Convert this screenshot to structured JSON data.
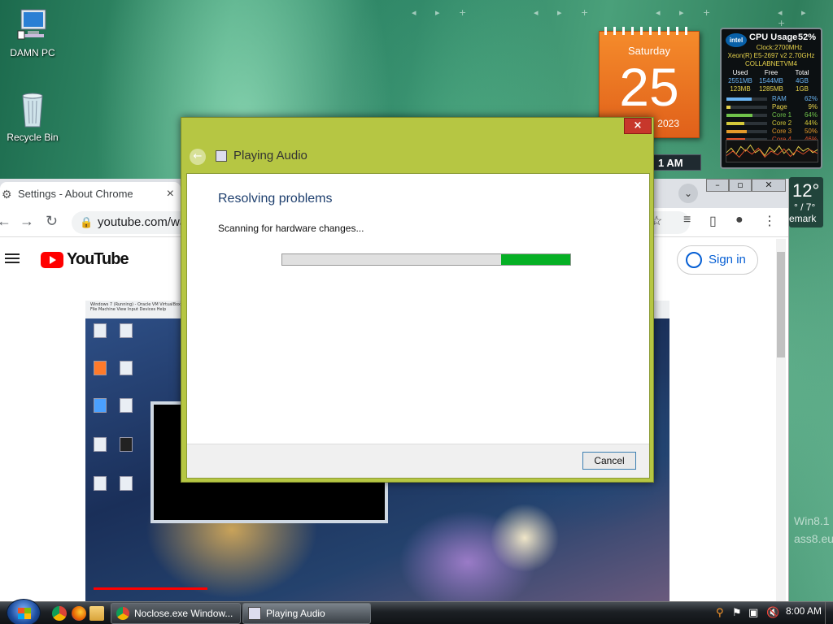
{
  "desktop": {
    "icons": [
      {
        "label": "DAMN PC"
      },
      {
        "label": "Recycle Bin"
      }
    ],
    "watermark": [
      "Win8.1",
      "ass8.eu"
    ]
  },
  "calendar": {
    "weekday": "Saturday",
    "day": "25",
    "year": "2023"
  },
  "clock_gadget": {
    "time": "1 AM"
  },
  "cpu_gadget": {
    "title": "CPU Usage",
    "percent": "52%",
    "clock": "Clock:2700MHz",
    "model": "Xeon(R) E5-2697 v2 2.70GHz",
    "host": "COLLABNETVM4",
    "headers": [
      "Used",
      "Free",
      "Total"
    ],
    "mem_row": [
      "2551MB",
      "1544MB",
      "4GB"
    ],
    "page_row": [
      "123MB",
      "1285MB",
      "1GB"
    ],
    "bars": [
      {
        "label": "RAM",
        "value": "62%",
        "level": 0.62,
        "color": "#69b3f1"
      },
      {
        "label": "Page",
        "value": "9%",
        "level": 0.09,
        "color": "#e6d24b"
      },
      {
        "label": "Core 1",
        "value": "64%",
        "level": 0.64,
        "color": "#70c24a"
      },
      {
        "label": "Core 2",
        "value": "44%",
        "level": 0.44,
        "color": "#d4c93a"
      },
      {
        "label": "Core 3",
        "value": "50%",
        "level": 0.5,
        "color": "#e49a2a"
      },
      {
        "label": "Core 4",
        "value": "46%",
        "level": 0.46,
        "color": "#e0502a"
      }
    ]
  },
  "weather": {
    "temp": "12°",
    "range": "° / 7°",
    "place": "emark"
  },
  "chrome": {
    "tab_title": "Settings - About Chrome",
    "tab_close": "×",
    "url": "youtube.com/wa",
    "yt_logo_text": "YouTube",
    "sign_in": "Sign in",
    "video_file_menu": "File   Machine   View   Input   Devices   Help",
    "video_titlebar": "Windows 7 (Running) - Oracle VM VirtualBox"
  },
  "dialog": {
    "title": "Playing Audio",
    "close": "×",
    "heading": "Resolving problems",
    "status": "Scanning for hardware changes...",
    "progress": 0.24,
    "progress_offset": 0.76,
    "cancel": "Cancel",
    "accent": "#06b025"
  },
  "taskbar": {
    "buttons": [
      {
        "label": "Noclose.exe Window..."
      },
      {
        "label": "Playing Audio"
      }
    ],
    "clock": "8:00 AM"
  },
  "icons": [
    "computer-icon",
    "recycle-bin-icon",
    "gear-icon",
    "back-arrow-icon",
    "forward-arrow-icon",
    "reload-icon",
    "lock-icon",
    "star-icon",
    "user-icon",
    "windows-logo-icon",
    "chrome-icon",
    "firefox-icon",
    "folder-icon"
  ]
}
